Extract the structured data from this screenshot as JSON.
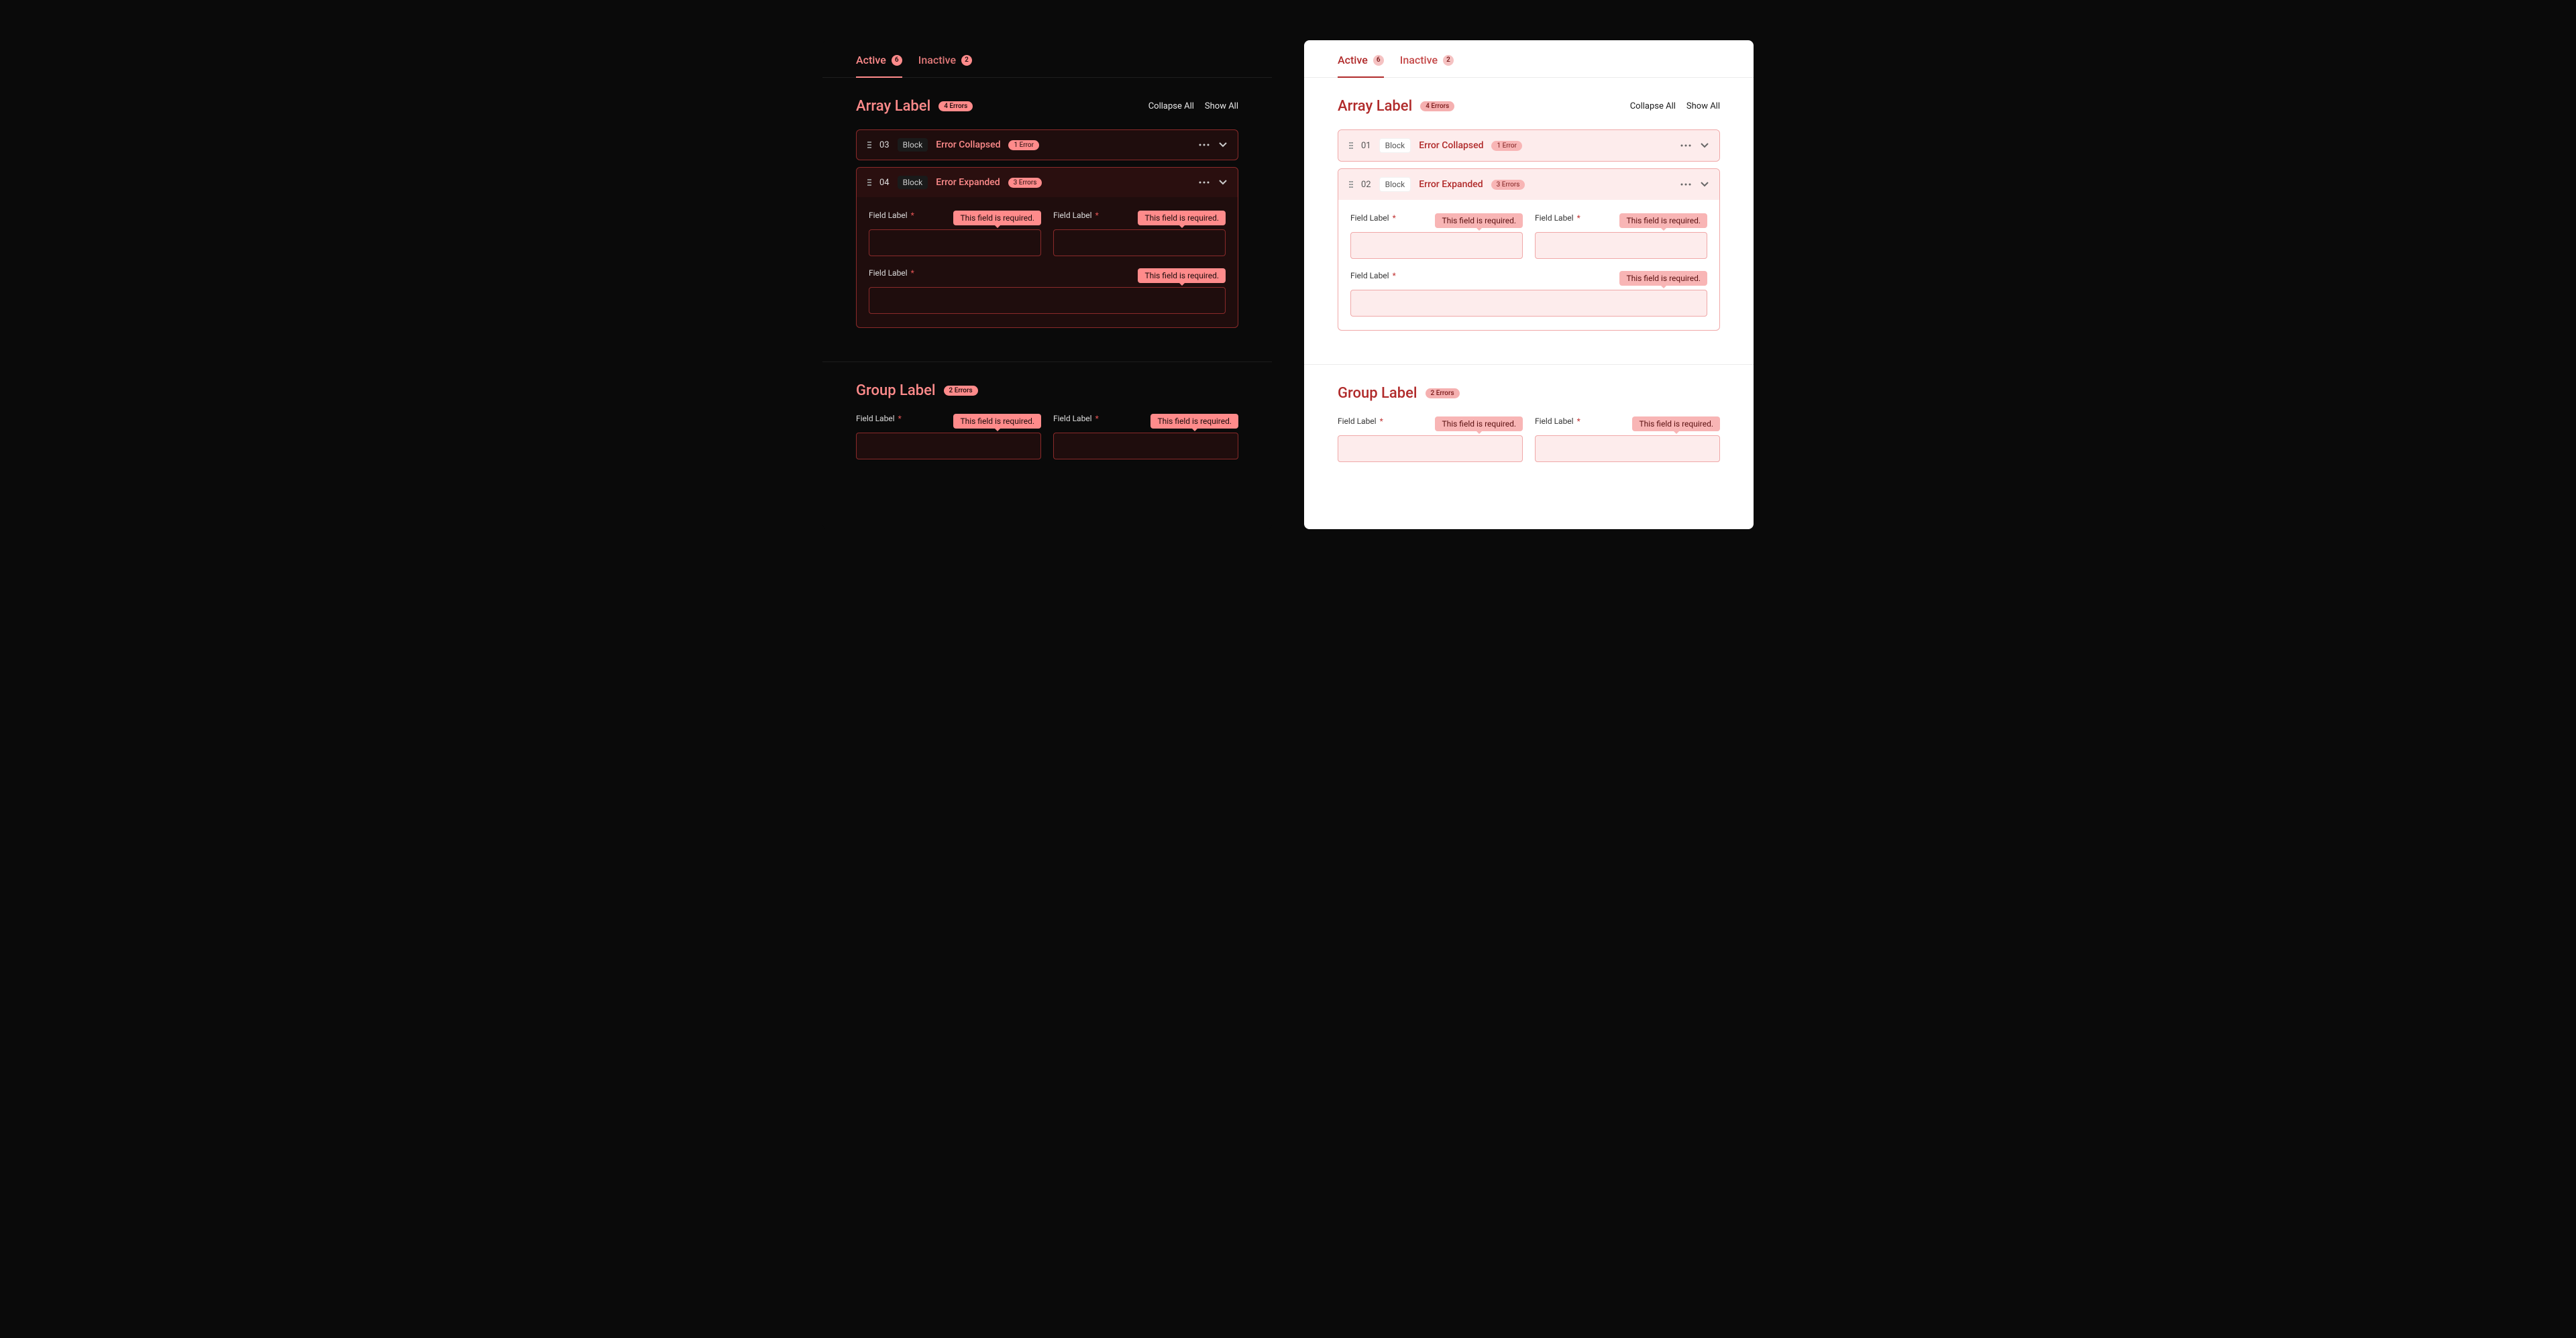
{
  "tabs": {
    "active_label": "Active",
    "active_count": "6",
    "inactive_label": "Inactive",
    "inactive_count": "2"
  },
  "array_section": {
    "title": "Array Label",
    "errors_badge": "4 Errors",
    "collapse_all": "Collapse All",
    "show_all": "Show All"
  },
  "rows_dark": {
    "collapsed": {
      "num": "03",
      "block": "Block",
      "title": "Error Collapsed",
      "errors": "1 Error"
    },
    "expanded": {
      "num": "04",
      "block": "Block",
      "title": "Error Expanded",
      "errors": "3 Errors"
    }
  },
  "rows_light": {
    "collapsed": {
      "num": "01",
      "block": "Block",
      "title": "Error Collapsed",
      "errors": "1 Error"
    },
    "expanded": {
      "num": "02",
      "block": "Block",
      "title": "Error Expanded",
      "errors": "3 Errors"
    }
  },
  "field": {
    "label": "Field Label",
    "required_marker": "*",
    "error_msg": "This field is required."
  },
  "group_section": {
    "title": "Group Label",
    "errors_badge": "2 Errors"
  }
}
